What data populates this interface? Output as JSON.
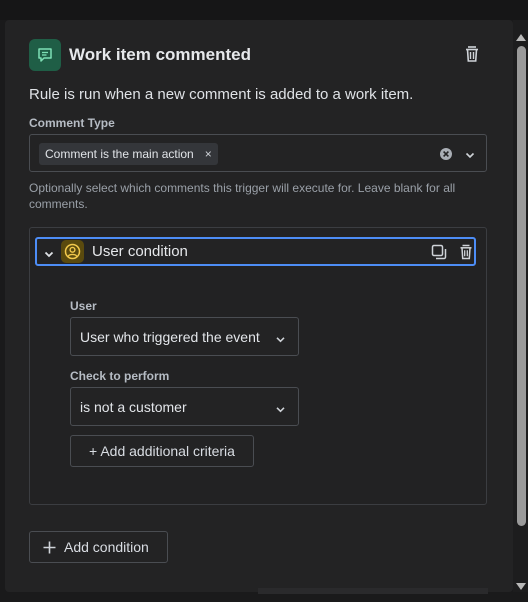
{
  "trigger": {
    "title": "Work item commented",
    "description": "Rule is run when a new comment is added to a work item."
  },
  "comment_type": {
    "label": "Comment Type",
    "selected_chip": "Comment is the main action",
    "chip_remove": "×",
    "helper": "Optionally select which comments this trigger will execute for. Leave blank for all comments."
  },
  "condition": {
    "title": "User condition",
    "user_label": "User",
    "user_value": "User who triggered the event",
    "check_label": "Check to perform",
    "check_value": "is not a customer",
    "add_criteria": "+ Add additional criteria"
  },
  "footer": {
    "add_condition": "Add condition"
  },
  "colors": {
    "accent_blue": "#4d8df6",
    "trigger_icon_bg": "#1f5e46",
    "user_icon_bg": "#5a4a0e",
    "user_icon_fg": "#f2c94c"
  }
}
